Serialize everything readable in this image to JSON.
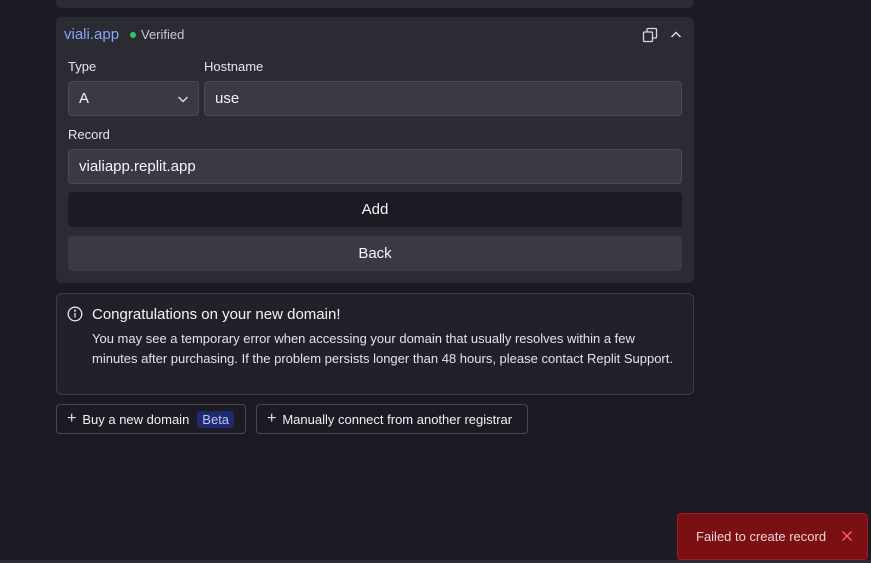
{
  "domain_card": {
    "domain_name": "viali.app",
    "status": "Verified",
    "type_label": "Type",
    "type_value": "A",
    "hostname_label": "Hostname",
    "hostname_value": "use",
    "record_label": "Record",
    "record_value": "vialiapp.replit.app",
    "add_label": "Add",
    "back_label": "Back"
  },
  "info": {
    "title": "Congratulations on your new domain!",
    "body": "You may see a temporary error when accessing your domain that usually resolves within a few minutes after purchasing. If the problem persists longer than 48 hours, please contact Replit Support."
  },
  "actions": {
    "buy_label": "Buy a new domain",
    "beta_badge": "Beta",
    "connect_label": "Manually connect from another registrar"
  },
  "toast": {
    "message": "Failed to create record"
  },
  "icons": {
    "copy": "copy-icon",
    "collapse": "chevron-up-icon",
    "dropdown": "chevron-down-icon",
    "info": "info-icon",
    "plus": "plus-icon",
    "close": "close-icon"
  },
  "colors": {
    "background": "#1c1b24",
    "card": "#2b2b33",
    "domain_link": "#84a6ff",
    "verified_dot": "#3fbf5f",
    "toast": "#7a0f14",
    "beta_badge": "#1e2a6b"
  }
}
